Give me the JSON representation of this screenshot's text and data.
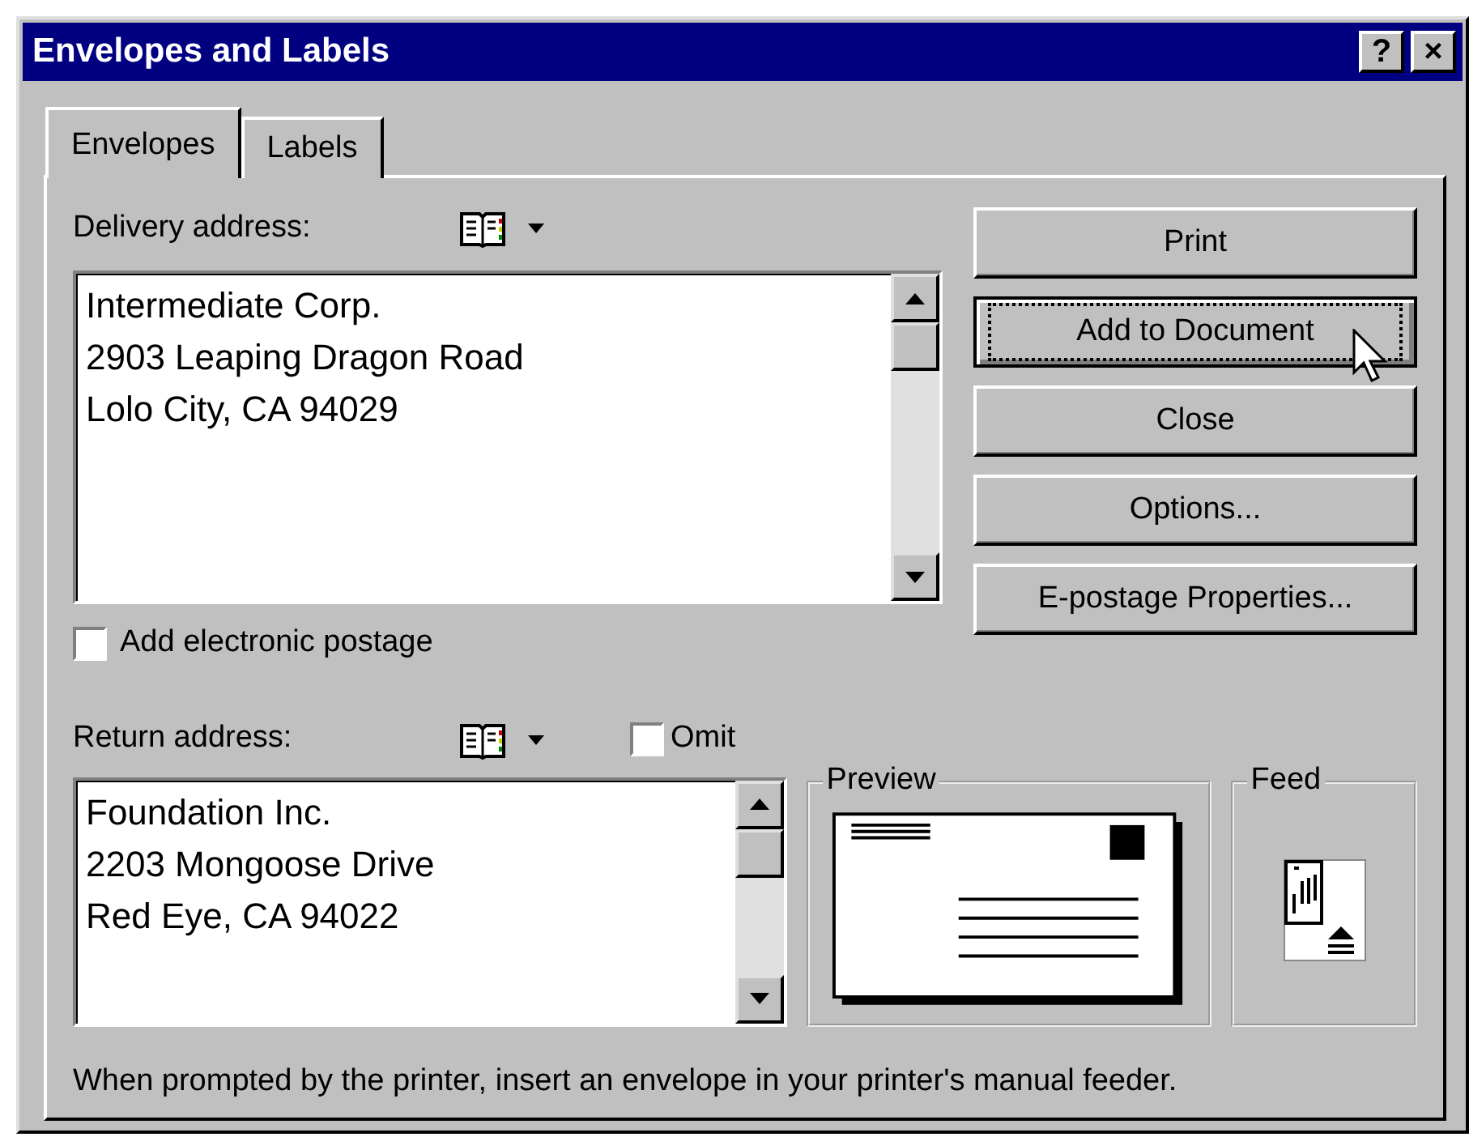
{
  "window": {
    "title": "Envelopes and Labels",
    "title_buttons": [
      {
        "kind": "help",
        "label": "?"
      },
      {
        "kind": "close",
        "label": "×"
      }
    ]
  },
  "tabs": [
    {
      "label": "Envelopes",
      "selected": true
    },
    {
      "label": "Labels",
      "selected": false
    }
  ],
  "delivery_address": {
    "label": "Delivery address:",
    "lines": [
      "Intermediate Corp.",
      "2903 Leaping Dragon Road",
      "Lolo City, CA 94029"
    ]
  },
  "electronic_postage": {
    "label": "Add electronic postage",
    "checked": false
  },
  "return_address": {
    "label": "Return address:",
    "lines": [
      "Foundation Inc.",
      "2203 Mongoose Drive",
      "Red Eye, CA 94022"
    ],
    "omit": {
      "label": "Omit",
      "checked": false
    }
  },
  "buttons": [
    {
      "label": "Print",
      "focused": false
    },
    {
      "label": "Add to Document",
      "focused": true
    },
    {
      "label": "Close",
      "focused": false
    },
    {
      "label": "Options...",
      "focused": false
    },
    {
      "label": "E-postage Properties...",
      "focused": false
    }
  ],
  "preview": {
    "title": "Preview"
  },
  "feed": {
    "title": "Feed"
  },
  "hint": "When prompted by the printer, insert an envelope in your printer's manual feeder."
}
